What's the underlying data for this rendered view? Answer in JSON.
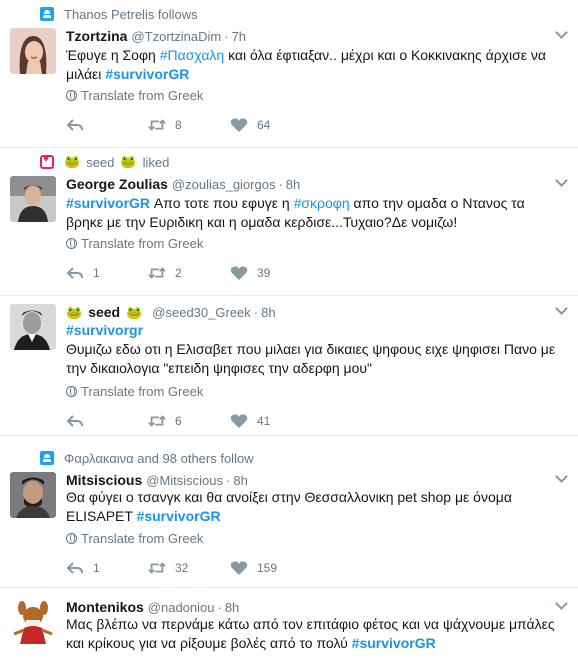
{
  "tweets": [
    {
      "context": "Thanos Petrelis follows",
      "name": "Tzortzina",
      "handle": "@TzortzinaDim",
      "time": "7h",
      "text_parts": [
        "Έφυγε η Σοφη ",
        "#Πασχαλη",
        " και όλα έφτιαξαν.. μέχρι και ο Κοκκινακης άρχισε να μιλάει ",
        "#survivorGR"
      ],
      "translate": "Translate from Greek",
      "replies": "",
      "retweets": "8",
      "likes": "64"
    },
    {
      "context_user": "seed",
      "context_action": "liked",
      "name": "George Zoulias",
      "handle": "@zoulias_giorgos",
      "time": "8h",
      "text_parts": [
        "#survivorGR",
        " Απο τοτε που εφυγε η ",
        "#σκροφη",
        " απο την ομαδα ο Ντανος τα βρηκε με την Ευριδικη και η ομαδα κερδισε...Τυχαιο?Δε νομιζω!"
      ],
      "translate": "Translate from Greek",
      "replies": "1",
      "retweets": "2",
      "likes": "39"
    },
    {
      "name": "seed",
      "handle": "@seed30_Greek",
      "time": "8h",
      "text_parts": [
        "#survivorgr",
        "Θυμιζω εδω οτι η Ελισαβετ που μιλαει για δικαιες ψηφους ειχε ψηφισει Πανο με την δικαιολογια \"επειδη ψηφισες την αδερφη μου\""
      ],
      "translate": "Translate from Greek",
      "replies": "",
      "retweets": "6",
      "likes": "41"
    },
    {
      "context": "Φαρλακαινα and 98 others follow",
      "name": "Mitsiscious",
      "handle": "@Mitsiscious",
      "time": "8h",
      "text_parts": [
        "Θα φύγει ο τσανγκ και θα ανοίξει στην Θεσσαλλονικη pet shop με όνομα ELISAPET  ",
        "#survivorGR"
      ],
      "translate": "Translate from Greek",
      "replies": "1",
      "retweets": "32",
      "likes": "159"
    },
    {
      "name": "Montenikos",
      "handle": "@nadoniou",
      "time": "8h",
      "text_parts": [
        "Μας βλέπω να περνάμε κάτω από τον επιτάφιο φέτος και να ψάχνουμε μπάλες και κρίκους για να ρίξουμε βολές από το πολύ ",
        "#survivorGR"
      ]
    }
  ],
  "icons": {
    "context_follow": "person-icon",
    "context_like": "heart-icon",
    "reply": "reply-icon",
    "retweet": "retweet-icon",
    "like": "heart-icon",
    "translate": "globe-icon",
    "more": "chevron-down-icon",
    "frog": "frog-emoji"
  },
  "colors": {
    "accent": "#1da1f2",
    "hashtag": "#1b95e0",
    "like": "#e0245e",
    "muted": "#657786"
  }
}
